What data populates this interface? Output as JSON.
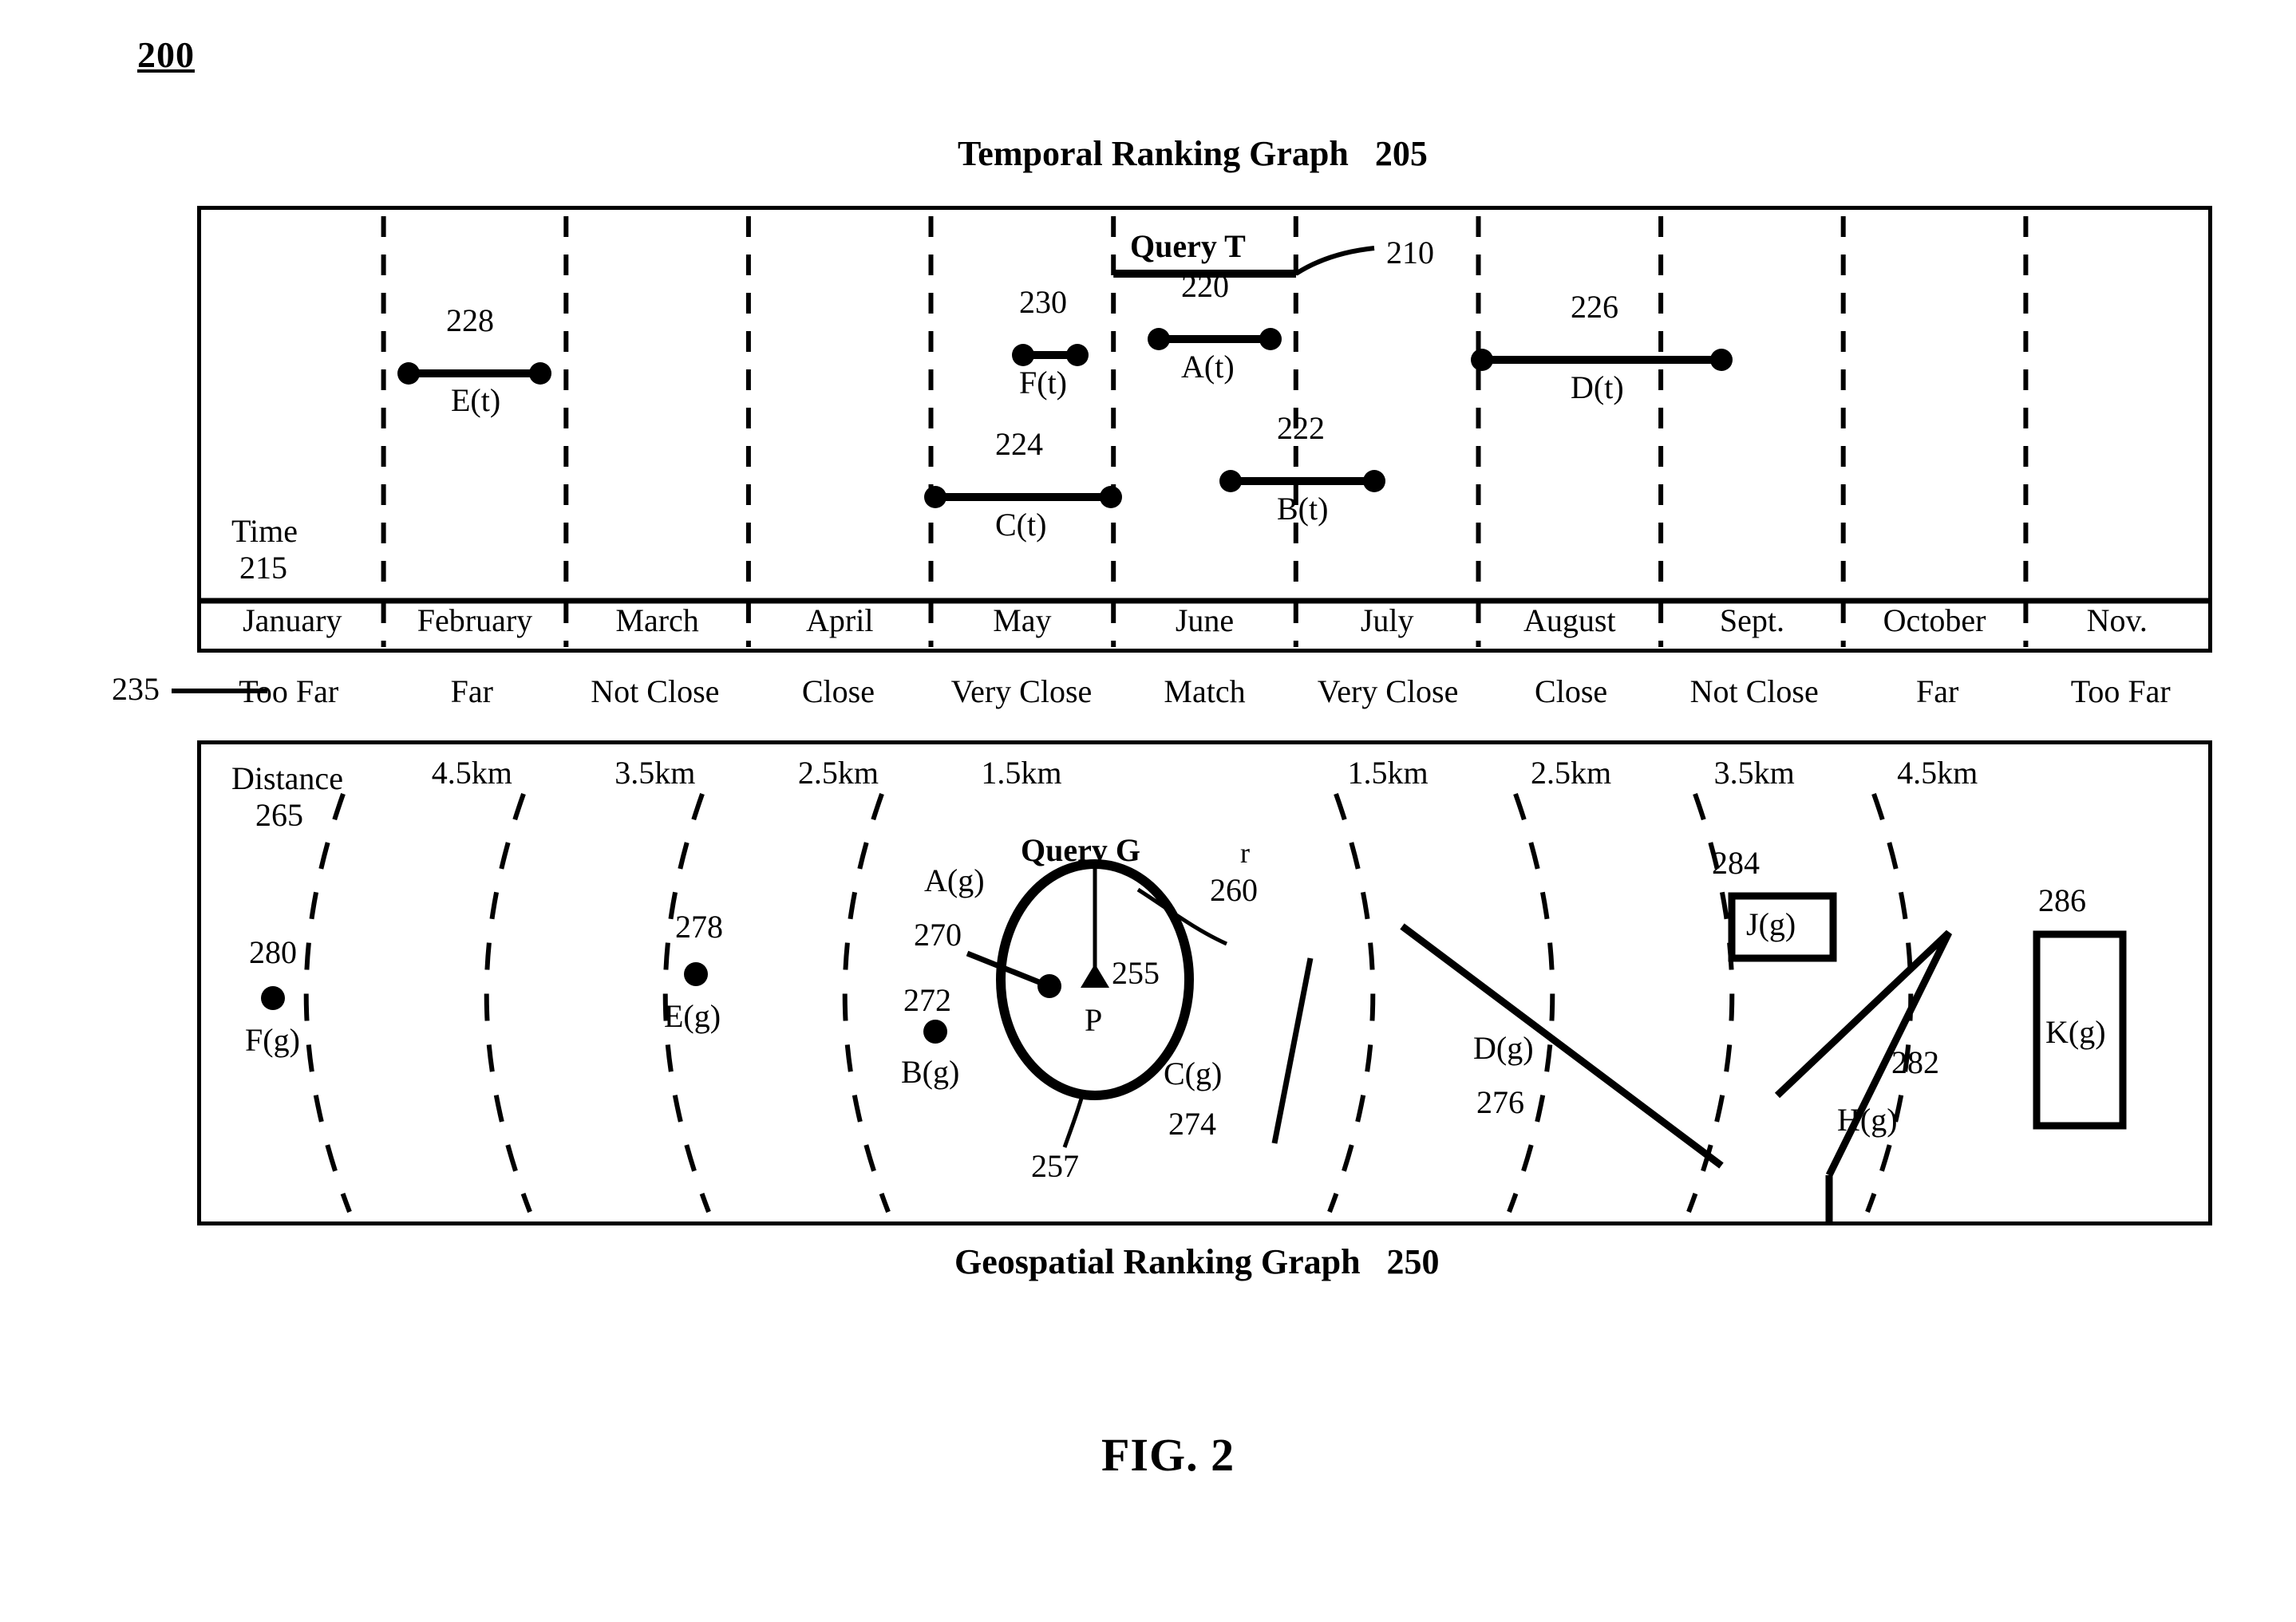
{
  "figure": {
    "number": "200",
    "caption": "FIG. 2"
  },
  "temporal_graph": {
    "title": "Temporal Ranking Graph   205",
    "axis_label": "Time",
    "axis_ref": "215",
    "query_label": "Query T",
    "query_ref": "210",
    "months": [
      "January",
      "February",
      "March",
      "April",
      "May",
      "June",
      "July",
      "August",
      "Sept.",
      "October",
      "Nov."
    ],
    "intervals": [
      {
        "ref": "228",
        "name": "E(t)",
        "start_month": 1.0,
        "end_month": 2.0
      },
      {
        "ref": "230",
        "name": "F(t)",
        "start_month": 4.35,
        "end_month": 4.75
      },
      {
        "ref": "220",
        "name": "A(t)",
        "start_month": 5.2,
        "end_month": 5.85
      },
      {
        "ref": "226",
        "name": "D(t)",
        "start_month": 7.0,
        "end_month": 8.3
      },
      {
        "ref": "224",
        "name": "C(t)",
        "start_month": 4.0,
        "end_month": 5.0
      },
      {
        "ref": "222",
        "name": "B(t)",
        "start_month": 5.7,
        "end_month": 6.45
      }
    ]
  },
  "ranking_scale": {
    "ref": "235",
    "labels": [
      "Too Far",
      "Far",
      "Not Close",
      "Close",
      "Very Close",
      "Match",
      "Very Close",
      "Close",
      "Not Close",
      "Far",
      "Too Far"
    ]
  },
  "geospatial_graph": {
    "title": "Geospatial Ranking Graph   250",
    "axis_label": "Distance",
    "axis_ref": "265",
    "distance_labels": [
      "",
      "4.5km",
      "3.5km",
      "2.5km",
      "1.5km",
      "",
      "1.5km",
      "2.5km",
      "3.5km",
      "4.5km",
      ""
    ],
    "query_label": "Query G",
    "query_circle_ref": "257",
    "query_point_label": "P",
    "query_point_ref": "255",
    "radius_label": "r",
    "radius_ref": "260",
    "entities": [
      {
        "ref": "270",
        "name": "A(g)",
        "shape": "point"
      },
      {
        "ref": "272",
        "name": "B(g)",
        "shape": "point"
      },
      {
        "ref": "274",
        "name": "C(g)",
        "shape": "line"
      },
      {
        "ref": "276",
        "name": "D(g)",
        "shape": "line"
      },
      {
        "ref": "278",
        "name": "E(g)",
        "shape": "point"
      },
      {
        "ref": "280",
        "name": "F(g)",
        "shape": "point"
      },
      {
        "ref": "282",
        "name": "H(g)",
        "shape": "polyline"
      },
      {
        "ref": "284",
        "name": "J(g)",
        "shape": "box"
      },
      {
        "ref": "286",
        "name": "K(g)",
        "shape": "box"
      }
    ]
  },
  "chart_data": {
    "type": "table",
    "title": "Temporal and Geospatial Ranking Graphs",
    "xlabel": "Time / Distance",
    "ylabel": "",
    "categories": [
      "January",
      "February",
      "March",
      "April",
      "May",
      "June",
      "July",
      "August",
      "Sept.",
      "October",
      "Nov."
    ],
    "series": [
      {
        "name": "E(t)",
        "values": [
          "February"
        ]
      },
      {
        "name": "F(t)",
        "values": [
          "May"
        ]
      },
      {
        "name": "A(t)",
        "values": [
          "June"
        ]
      },
      {
        "name": "D(t)",
        "values": [
          "August",
          "Sept."
        ]
      },
      {
        "name": "C(t)",
        "values": [
          "May"
        ]
      },
      {
        "name": "B(t)",
        "values": [
          "June",
          "July"
        ]
      }
    ]
  }
}
